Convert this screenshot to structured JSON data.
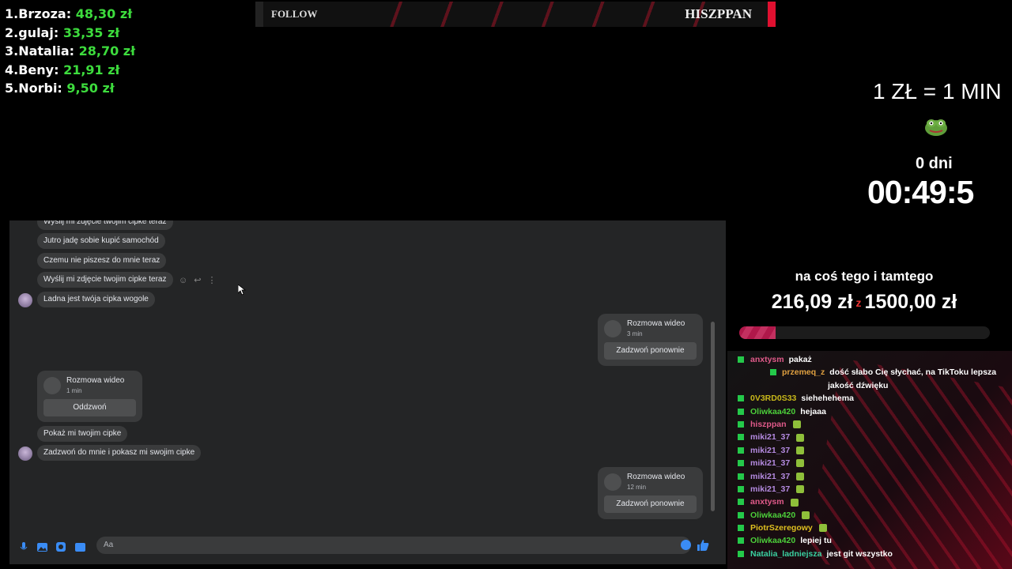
{
  "leaderboard": [
    {
      "rank": "1.",
      "name": "Brzoza:",
      "amount": "48,30 zł"
    },
    {
      "rank": "2.",
      "name": "gulaj:",
      "amount": "33,35 zł"
    },
    {
      "rank": "3.",
      "name": "Natalia:",
      "amount": "28,70 zł"
    },
    {
      "rank": "4.",
      "name": "Beny:",
      "amount": "21,91 zł"
    },
    {
      "rank": "5.",
      "name": "Norbi:",
      "amount": "9,50 zł"
    }
  ],
  "follow_bar": {
    "follow_label": "FOLLOW",
    "name": "HISZPPAN",
    "accent": "#e01030"
  },
  "subathon": {
    "rate": "1 ZŁ = 1 MIN",
    "emote": "pepe-emote",
    "days": "0 dni",
    "timer": "00:49:5"
  },
  "goal": {
    "title": "na coś tego i tamtego",
    "current": "216,09 zł",
    "separator": "z",
    "target": "1500,00 zł",
    "progress_fraction": 0.144
  },
  "messenger": {
    "messages": [
      {
        "text": "Wyślij mi zdjęcie twojim cipke teraz",
        "side": "left"
      },
      {
        "text": "Jutro jadę sobie kupić samochód",
        "side": "left"
      },
      {
        "text": "Czemu nie piszesz do mnie teraz",
        "side": "left"
      },
      {
        "text": "Wyślij mi zdjęcie twojim cipke teraz",
        "side": "left"
      },
      {
        "text": "Ladna jest twója cipka wogole",
        "side": "left"
      },
      {
        "text": "Pokaż mi twojim cipke",
        "side": "left"
      },
      {
        "text": "Zadzwoń do mnie i pokasz mi swojim cipke",
        "side": "left"
      }
    ],
    "calls": [
      {
        "title": "Rozmowa wideo",
        "duration": "3 min",
        "button": "Zadzwoń ponownie"
      },
      {
        "title": "Rozmowa wideo",
        "duration": "1 min",
        "button": "Oddzwoń"
      },
      {
        "title": "Rozmowa wideo",
        "duration": "12 min",
        "button": "Zadzwoń ponownie"
      }
    ],
    "composer_placeholder": "Aa",
    "accent": "#3a8cf5"
  },
  "chat": [
    {
      "user": "anxtysm",
      "color": "#e05a8a",
      "text": "pakaż"
    },
    {
      "user": "przemeq_z",
      "color": "#e0a040",
      "text": "dość słabo Cię słychać, na TikToku lepsza",
      "indent": true
    },
    {
      "wrap": "jakość dźwięku"
    },
    {
      "user": "0V3RD0S33",
      "color": "#c8b81a",
      "text": "siehehehema"
    },
    {
      "user": "Oliwkaa420",
      "color": "#4ccf3a",
      "text": "hejaaa"
    },
    {
      "user": "hiszppan",
      "color": "#e05a8a",
      "text": "",
      "emote": "emote"
    },
    {
      "user": "miki21_37",
      "color": "#b48ae0",
      "text": "",
      "emote": "emote"
    },
    {
      "user": "miki21_37",
      "color": "#b48ae0",
      "text": "",
      "emote": "emote"
    },
    {
      "user": "miki21_37",
      "color": "#b48ae0",
      "text": "",
      "emote": "emote"
    },
    {
      "user": "miki21_37",
      "color": "#b48ae0",
      "text": "",
      "emote": "emote"
    },
    {
      "user": "miki21_37",
      "color": "#b48ae0",
      "text": "",
      "emote": "emote"
    },
    {
      "user": "anxtysm",
      "color": "#e05a8a",
      "text": "",
      "emote": "emote"
    },
    {
      "user": "Oliwkaa420",
      "color": "#4ccf3a",
      "text": "",
      "emote": "emote"
    },
    {
      "user": "PiotrSzeregowy",
      "color": "#e0c020",
      "text": "",
      "emote": "emote"
    },
    {
      "user": "Oliwkaa420",
      "color": "#4ccf3a",
      "text": "lepiej tu"
    },
    {
      "user": "Natalia_ladniejsza",
      "color": "#3ad0a0",
      "text": "jest git wszystko"
    }
  ]
}
